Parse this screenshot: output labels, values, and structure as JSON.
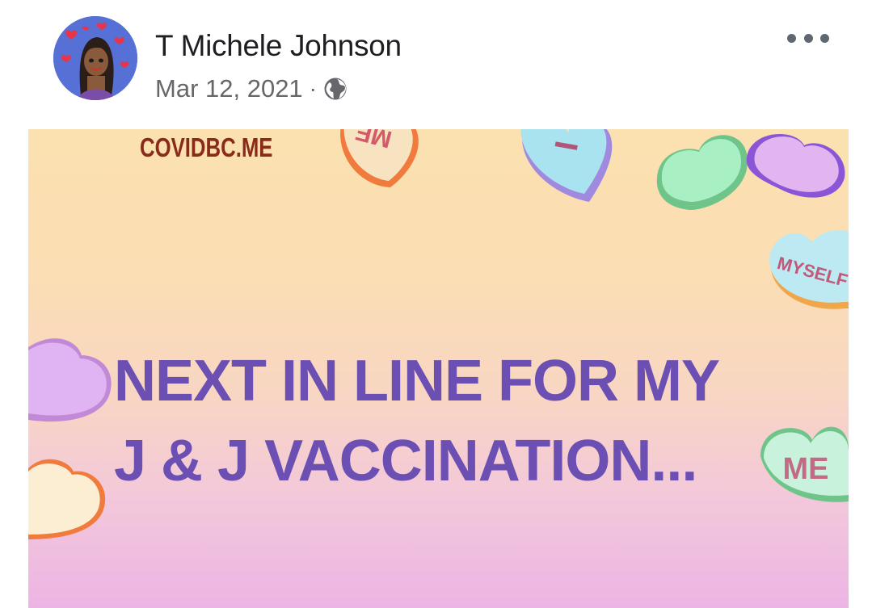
{
  "post": {
    "author": "T Michele Johnson",
    "date": "Mar 12, 2021",
    "separator": "·",
    "audience_icon": "globe-icon",
    "more_icon": "more-options-icon"
  },
  "image": {
    "site_text": "COVIDBC.ME",
    "headline_line1": "NEXT IN LINE FOR MY",
    "headline_line2": "J & J VACCINATION...",
    "hearts": [
      "ME",
      "I",
      "MYSELF",
      "ME"
    ],
    "colors": {
      "headline": "#6b4fb3",
      "site_text": "#8a2a1a",
      "bg_top": "#fbe0b0",
      "bg_bottom": "#ecb4e4"
    }
  }
}
